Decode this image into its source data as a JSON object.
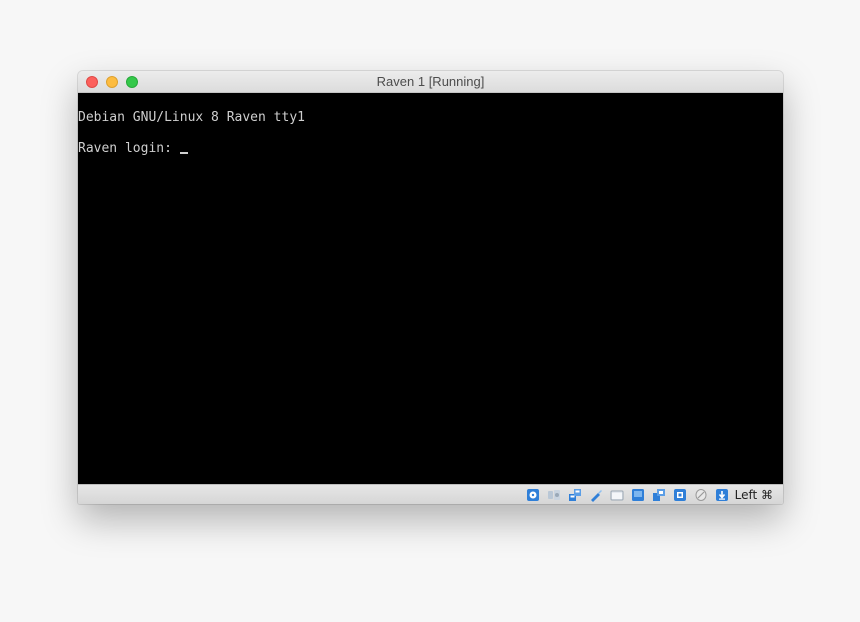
{
  "window": {
    "title": "Raven 1 [Running]"
  },
  "console": {
    "lines": [
      "Debian GNU/Linux 8 Raven tty1",
      "Raven login: "
    ]
  },
  "statusbar": {
    "icons": [
      "hard-disk-icon",
      "optical-drive-icon",
      "network-icon",
      "usb-icon",
      "shared-folders-icon",
      "display-icon",
      "video-capture-icon",
      "cpu-icon",
      "mouse-integration-icon",
      "keyboard-capture-icon"
    ],
    "host_key": "Left ⌘"
  },
  "colors": {
    "close": "#fc605c",
    "minimize": "#fdbc40",
    "maximize": "#34c84a",
    "console_bg": "#000000",
    "console_fg": "#cfcfcf",
    "icon_blue": "#2f7fd8"
  }
}
